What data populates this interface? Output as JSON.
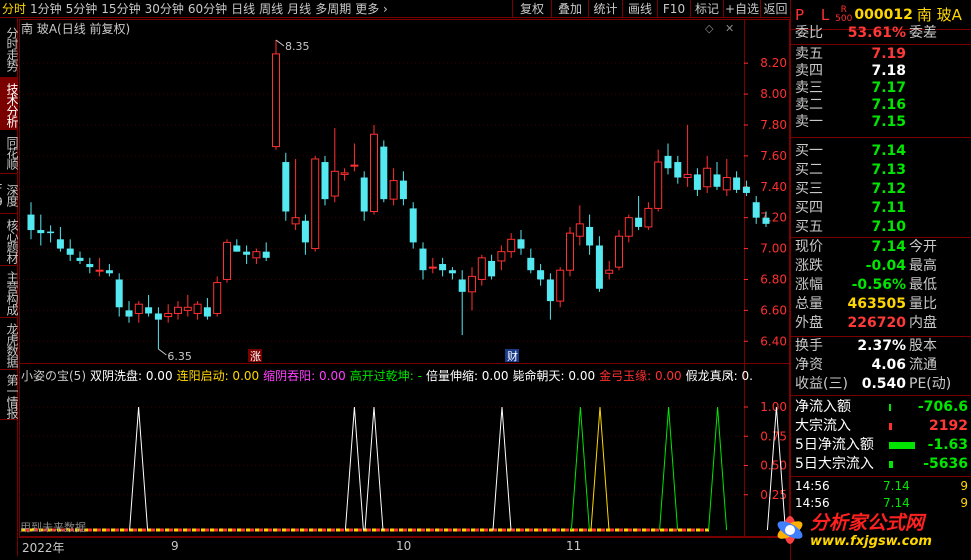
{
  "toolbar": {
    "periods": [
      "分时",
      "1分钟",
      "5分钟",
      "15分钟",
      "30分钟",
      "60分钟",
      "日线",
      "周线",
      "月线",
      "多周期",
      "更多 ›"
    ],
    "active_period": 0,
    "buttons": [
      "复权",
      "叠加",
      "统计",
      "画线",
      "F10",
      "标记",
      "+自选",
      "返回"
    ]
  },
  "left_tabs": [
    {
      "label": "分时走势",
      "active": false
    },
    {
      "label": "技术分析",
      "active": true
    },
    {
      "label": "同花顺",
      "active": false
    },
    {
      "label": "深度F9",
      "active": false
    },
    {
      "label": "核心题材",
      "active": false
    },
    {
      "label": "主营构成",
      "active": false
    },
    {
      "label": "龙虎数据",
      "active": false
    },
    {
      "label": "第一情报",
      "active": false
    }
  ],
  "main_chart": {
    "title": "南 玻A(日线 前复权)",
    "y_ticks": [
      "8.20",
      "8.00",
      "7.80",
      "7.60",
      "7.40",
      "7.20",
      "7.00",
      "6.80",
      "6.60",
      "6.40"
    ],
    "high_label": "8.35",
    "low_label": "6.35",
    "marker_up": "涨",
    "marker_cai": "财"
  },
  "indicator": {
    "name": "小姿の宝(5)",
    "items": [
      {
        "label": "双阴洗盘: 0.00",
        "color": "#ffffff"
      },
      {
        "label": "连阳启动: 0.00",
        "color": "#ffd700"
      },
      {
        "label": "缩阴吞阳: 0.00",
        "color": "#ff40ff"
      },
      {
        "label": "高开过乾坤: -",
        "color": "#00e600"
      },
      {
        "label": "倍量伸缩: 0.00",
        "color": "#ffffff"
      },
      {
        "label": "毙命朝天: 0.00",
        "color": "#ffffff"
      },
      {
        "label": "金弓玉缘: 0.00",
        "color": "#ff3030"
      },
      {
        "label": "假龙真凤: 0.",
        "color": "#ffffff"
      }
    ],
    "y_ticks": [
      "1.00",
      "0.75",
      "0.50",
      "0.25"
    ],
    "future_note": "用到未来数据"
  },
  "date_axis": [
    "2022年",
    "9",
    "10",
    "11"
  ],
  "quote": {
    "pl": "P L",
    "r_badge": "R\n500",
    "code": "000012",
    "name": "南 玻A",
    "weibi_label": "委比",
    "weibi": "53.61%",
    "weicha_label": "委差",
    "asks": [
      {
        "label": "卖五",
        "price": "7.19",
        "color": "red"
      },
      {
        "label": "卖四",
        "price": "7.18",
        "color": "white"
      },
      {
        "label": "卖三",
        "price": "7.17",
        "color": "green"
      },
      {
        "label": "卖二",
        "price": "7.16",
        "color": "green"
      },
      {
        "label": "卖一",
        "price": "7.15",
        "color": "green"
      }
    ],
    "bids": [
      {
        "label": "买一",
        "price": "7.14",
        "color": "green"
      },
      {
        "label": "买二",
        "price": "7.13",
        "color": "green"
      },
      {
        "label": "买三",
        "price": "7.12",
        "color": "green"
      },
      {
        "label": "买四",
        "price": "7.11",
        "color": "green"
      },
      {
        "label": "买五",
        "price": "7.10",
        "color": "green"
      }
    ],
    "stats": [
      {
        "label": "现价",
        "value": "7.14",
        "vcolor": "green",
        "label2": "今开"
      },
      {
        "label": "涨跌",
        "value": "-0.04",
        "vcolor": "green",
        "label2": "最高"
      },
      {
        "label": "涨幅",
        "value": "-0.56%",
        "vcolor": "green",
        "label2": "最低"
      },
      {
        "label": "总量",
        "value": "463505",
        "vcolor": "yellow",
        "label2": "量比"
      },
      {
        "label": "外盘",
        "value": "226720",
        "vcolor": "red",
        "label2": "内盘"
      }
    ],
    "stats2": [
      {
        "label": "换手",
        "value": "2.37%",
        "label2": "股本"
      },
      {
        "label": "净资",
        "value": "4.06",
        "label2": "流通"
      },
      {
        "label": "收益(三)",
        "value": "0.540",
        "label2": "PE(动)"
      }
    ],
    "flows": [
      {
        "label": "净流入额",
        "value": "-706.6",
        "vcolor": "green",
        "bar": "#00e600",
        "barw": 2
      },
      {
        "label": "大宗流入",
        "value": "2192",
        "vcolor": "red",
        "bar": "#ff3030",
        "barw": 3
      },
      {
        "label": "5日净流入额",
        "value": "-1.63",
        "vcolor": "green",
        "bar": "#00e600",
        "barw": 26
      },
      {
        "label": "5日大宗流入",
        "value": "-5636",
        "vcolor": "green",
        "bar": "#00e600",
        "barw": 4
      }
    ],
    "ticks": [
      {
        "time": "14:56",
        "price": "7.14",
        "vol": "9"
      },
      {
        "time": "14:56",
        "price": "7.14",
        "vol": "9"
      }
    ]
  },
  "logo": {
    "text1": "分析家公式网",
    "text2": "www.fxjgsw.com"
  },
  "chart_data": {
    "type": "candlestick",
    "y_range": [
      6.35,
      8.35
    ],
    "candles": [
      {
        "o": 7.22,
        "h": 7.3,
        "l": 7.06,
        "c": 7.12
      },
      {
        "o": 7.12,
        "h": 7.22,
        "l": 7.02,
        "c": 7.1
      },
      {
        "o": 7.11,
        "h": 7.15,
        "l": 7.04,
        "c": 7.1
      },
      {
        "o": 7.06,
        "h": 7.14,
        "l": 6.98,
        "c": 7.0
      },
      {
        "o": 7.0,
        "h": 7.06,
        "l": 6.92,
        "c": 6.96
      },
      {
        "o": 6.94,
        "h": 6.98,
        "l": 6.9,
        "c": 6.92
      },
      {
        "o": 6.9,
        "h": 6.94,
        "l": 6.84,
        "c": 6.88
      },
      {
        "o": 6.86,
        "h": 6.94,
        "l": 6.82,
        "c": 6.86
      },
      {
        "o": 6.86,
        "h": 6.9,
        "l": 6.82,
        "c": 6.84
      },
      {
        "o": 6.8,
        "h": 6.84,
        "l": 6.56,
        "c": 6.62
      },
      {
        "o": 6.6,
        "h": 6.66,
        "l": 6.52,
        "c": 6.56
      },
      {
        "o": 6.58,
        "h": 6.66,
        "l": 6.52,
        "c": 6.64
      },
      {
        "o": 6.62,
        "h": 6.7,
        "l": 6.56,
        "c": 6.58
      },
      {
        "o": 6.58,
        "h": 6.62,
        "l": 6.35,
        "c": 6.54
      },
      {
        "o": 6.56,
        "h": 6.64,
        "l": 6.52,
        "c": 6.58
      },
      {
        "o": 6.58,
        "h": 6.66,
        "l": 6.54,
        "c": 6.62
      },
      {
        "o": 6.6,
        "h": 6.7,
        "l": 6.56,
        "c": 6.62
      },
      {
        "o": 6.58,
        "h": 6.66,
        "l": 6.54,
        "c": 6.64
      },
      {
        "o": 6.62,
        "h": 6.68,
        "l": 6.54,
        "c": 6.56
      },
      {
        "o": 6.58,
        "h": 6.82,
        "l": 6.56,
        "c": 6.78
      },
      {
        "o": 6.8,
        "h": 7.06,
        "l": 6.78,
        "c": 7.04
      },
      {
        "o": 7.02,
        "h": 7.06,
        "l": 6.98,
        "c": 6.98
      },
      {
        "o": 6.98,
        "h": 7.02,
        "l": 6.9,
        "c": 6.96
      },
      {
        "o": 6.94,
        "h": 7.0,
        "l": 6.9,
        "c": 6.98
      },
      {
        "o": 6.98,
        "h": 7.04,
        "l": 6.92,
        "c": 6.94
      },
      {
        "o": 7.66,
        "h": 8.35,
        "l": 7.64,
        "c": 8.26
      },
      {
        "o": 7.56,
        "h": 7.62,
        "l": 7.18,
        "c": 7.24
      },
      {
        "o": 7.16,
        "h": 7.58,
        "l": 7.12,
        "c": 7.2
      },
      {
        "o": 7.18,
        "h": 7.22,
        "l": 6.96,
        "c": 7.04
      },
      {
        "o": 7.0,
        "h": 7.6,
        "l": 6.98,
        "c": 7.58
      },
      {
        "o": 7.56,
        "h": 7.6,
        "l": 7.28,
        "c": 7.32
      },
      {
        "o": 7.34,
        "h": 7.78,
        "l": 7.3,
        "c": 7.5
      },
      {
        "o": 7.48,
        "h": 7.52,
        "l": 7.44,
        "c": 7.49
      },
      {
        "o": 7.54,
        "h": 7.68,
        "l": 7.5,
        "c": 7.54
      },
      {
        "o": 7.46,
        "h": 7.5,
        "l": 7.18,
        "c": 7.24
      },
      {
        "o": 7.24,
        "h": 7.8,
        "l": 7.22,
        "c": 7.74
      },
      {
        "o": 7.66,
        "h": 7.7,
        "l": 7.3,
        "c": 7.32
      },
      {
        "o": 7.32,
        "h": 7.52,
        "l": 7.28,
        "c": 7.44
      },
      {
        "o": 7.44,
        "h": 7.5,
        "l": 7.28,
        "c": 7.32
      },
      {
        "o": 7.26,
        "h": 7.3,
        "l": 7.0,
        "c": 7.04
      },
      {
        "o": 7.0,
        "h": 7.04,
        "l": 6.8,
        "c": 6.86
      },
      {
        "o": 6.88,
        "h": 6.94,
        "l": 6.84,
        "c": 6.88
      },
      {
        "o": 6.9,
        "h": 6.94,
        "l": 6.82,
        "c": 6.86
      },
      {
        "o": 6.86,
        "h": 6.88,
        "l": 6.8,
        "c": 6.84
      },
      {
        "o": 6.8,
        "h": 6.86,
        "l": 6.44,
        "c": 6.72
      },
      {
        "o": 6.72,
        "h": 6.88,
        "l": 6.6,
        "c": 6.82
      },
      {
        "o": 6.8,
        "h": 6.96,
        "l": 6.76,
        "c": 6.94
      },
      {
        "o": 6.92,
        "h": 6.96,
        "l": 6.8,
        "c": 6.82
      },
      {
        "o": 6.92,
        "h": 7.02,
        "l": 6.86,
        "c": 6.98
      },
      {
        "o": 6.98,
        "h": 7.1,
        "l": 6.94,
        "c": 7.06
      },
      {
        "o": 7.06,
        "h": 7.12,
        "l": 6.96,
        "c": 7.0
      },
      {
        "o": 6.94,
        "h": 7.0,
        "l": 6.84,
        "c": 6.86
      },
      {
        "o": 6.86,
        "h": 6.9,
        "l": 6.76,
        "c": 6.8
      },
      {
        "o": 6.8,
        "h": 6.84,
        "l": 6.54,
        "c": 6.66
      },
      {
        "o": 6.66,
        "h": 6.88,
        "l": 6.62,
        "c": 6.86
      },
      {
        "o": 6.86,
        "h": 7.14,
        "l": 6.82,
        "c": 7.1
      },
      {
        "o": 7.08,
        "h": 7.28,
        "l": 7.02,
        "c": 7.16
      },
      {
        "o": 7.14,
        "h": 7.22,
        "l": 6.96,
        "c": 7.02
      },
      {
        "o": 7.02,
        "h": 7.08,
        "l": 6.72,
        "c": 6.74
      },
      {
        "o": 6.84,
        "h": 6.92,
        "l": 6.8,
        "c": 6.86
      },
      {
        "o": 6.88,
        "h": 7.12,
        "l": 6.86,
        "c": 7.08
      },
      {
        "o": 7.08,
        "h": 7.22,
        "l": 7.04,
        "c": 7.2
      },
      {
        "o": 7.2,
        "h": 7.34,
        "l": 7.12,
        "c": 7.14
      },
      {
        "o": 7.14,
        "h": 7.3,
        "l": 7.12,
        "c": 7.26
      },
      {
        "o": 7.26,
        "h": 7.64,
        "l": 7.24,
        "c": 7.56
      },
      {
        "o": 7.6,
        "h": 7.68,
        "l": 7.48,
        "c": 7.52
      },
      {
        "o": 7.56,
        "h": 7.6,
        "l": 7.42,
        "c": 7.46
      },
      {
        "o": 7.46,
        "h": 7.8,
        "l": 7.4,
        "c": 7.48
      },
      {
        "o": 7.48,
        "h": 7.52,
        "l": 7.34,
        "c": 7.38
      },
      {
        "o": 7.4,
        "h": 7.6,
        "l": 7.36,
        "c": 7.52
      },
      {
        "o": 7.48,
        "h": 7.56,
        "l": 7.38,
        "c": 7.4
      },
      {
        "o": 7.38,
        "h": 7.58,
        "l": 7.34,
        "c": 7.46
      },
      {
        "o": 7.46,
        "h": 7.5,
        "l": 7.36,
        "c": 7.38
      },
      {
        "o": 7.4,
        "h": 7.44,
        "l": 7.34,
        "c": 7.36
      },
      {
        "o": 7.3,
        "h": 7.34,
        "l": 7.16,
        "c": 7.2
      },
      {
        "o": 7.2,
        "h": 7.24,
        "l": 7.14,
        "c": 7.16
      }
    ],
    "signals": [
      {
        "index": 12,
        "value": 1.0,
        "color": "#ffffff"
      },
      {
        "index": 33,
        "value": 1.0,
        "color": "#ffffff"
      },
      {
        "index": 35,
        "value": 1.0,
        "color": "#ffffff"
      },
      {
        "index": 45,
        "value": 1.0,
        "color": "#ffffff"
      },
      {
        "index": 53,
        "value": 1.0,
        "color": "#00e600"
      },
      {
        "index": 55,
        "value": 1.0,
        "color": "#ffd700"
      },
      {
        "index": 62,
        "value": 1.0,
        "color": "#00e600"
      },
      {
        "index": 67,
        "value": 1.0,
        "color": "#00e600"
      },
      {
        "index": 73,
        "value": 1.0,
        "color": "#ffffff"
      }
    ]
  }
}
